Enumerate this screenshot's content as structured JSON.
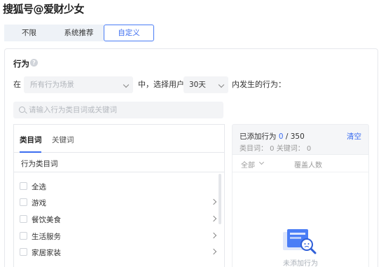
{
  "watermark": "搜狐号@爱财少女",
  "segments": [
    "不限",
    "系统推荐",
    "自定义"
  ],
  "behavior": {
    "title": "行为",
    "in_label": "在",
    "scene_placeholder": "所有行为场景",
    "middle_label": "中，选择用户",
    "days_value": "30天",
    "suffix_label": "内发生的行为：",
    "search_placeholder": "请输入行为类目词或关键词"
  },
  "left_panel": {
    "tabs": [
      "类目词",
      "关键词"
    ],
    "category_header": "行为类目词",
    "items": [
      "全选",
      "游戏",
      "餐饮美食",
      "生活服务",
      "家居家装"
    ]
  },
  "right_panel": {
    "added_prefix": "已添加行为",
    "added_count": "0",
    "added_total": "/ 350",
    "clear_label": "清空",
    "counts_text": "类目词： 0    关键词： 0",
    "col_all": "全部",
    "col_cover": "覆盖人数",
    "empty_text": "未添加行为"
  },
  "colors": {
    "accent": "#3d6ef0",
    "bg_input": "#f3f4f6",
    "border": "#e6e8ec"
  }
}
